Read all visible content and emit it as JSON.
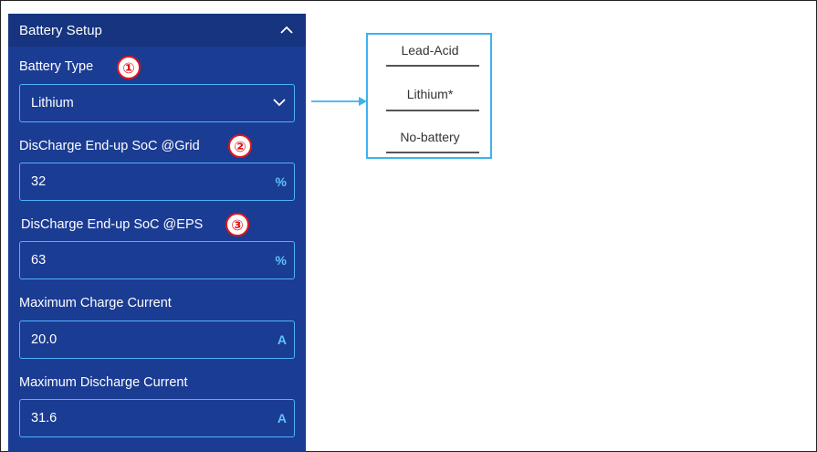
{
  "panel": {
    "title": "Battery Setup",
    "collapse_icon": "chevron-up-icon",
    "fields": [
      {
        "label": "Battery Type",
        "value": "Lithium",
        "kind": "select"
      },
      {
        "label": "DisCharge End-up SoC @Grid",
        "value": "32",
        "unit": "%"
      },
      {
        "label": "DisCharge End-up SoC @EPS",
        "value": "63",
        "unit": "%"
      },
      {
        "label": "Maximum Charge Current",
        "value": "20.0",
        "unit": "A"
      },
      {
        "label": "Maximum Discharge Current",
        "value": "31.6",
        "unit": "A"
      }
    ]
  },
  "callouts": [
    "①",
    "②",
    "③"
  ],
  "battery_options": [
    "Lead-Acid",
    "Lithium*",
    "No-battery"
  ],
  "colors": {
    "panel_bg": "#1b3c93",
    "field_border": "#4fb2ff",
    "callout_red": "#e0161b",
    "options_border": "#3db2f0"
  }
}
